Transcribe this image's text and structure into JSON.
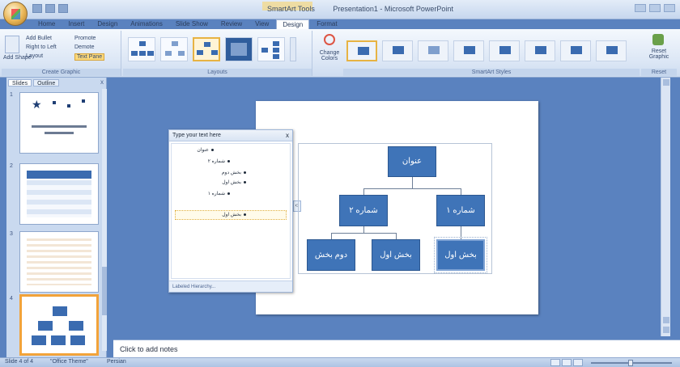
{
  "window": {
    "title": "SmartArt Tools",
    "title_full": "Presentation1 - Microsoft PowerPoint"
  },
  "tabs": [
    "Home",
    "Insert",
    "Design",
    "Animations",
    "Slide Show",
    "Review",
    "View",
    "Design",
    "Format"
  ],
  "ribbon": {
    "create_graphic": {
      "label": "Create Graphic",
      "add_shape": "Add Shape",
      "add_bullet": "Add Bullet",
      "right_to_left": "Right to Left",
      "layout": "Layout",
      "promote": "Promote",
      "demote": "Demote",
      "text_pane": "Text Pane"
    },
    "layouts": {
      "label": "Layouts"
    },
    "change_colors": "Change Colors",
    "styles": {
      "label": "SmartArt Styles"
    },
    "reset": {
      "label": "Reset",
      "reset_graphic": "Reset Graphic"
    }
  },
  "panel": {
    "tabs": [
      "Slides",
      "Outline"
    ],
    "close": "x",
    "slides": [
      {
        "num": "1"
      },
      {
        "num": "2"
      },
      {
        "num": "3"
      },
      {
        "num": "4"
      }
    ]
  },
  "text_pane": {
    "header": "Type your text here",
    "close": "x",
    "items": [
      {
        "text": "عنوان",
        "level": 0
      },
      {
        "text": "شماره ۲",
        "level": 1
      },
      {
        "text": "بخش دوم",
        "level": 2
      },
      {
        "text": "بخش اول",
        "level": 2
      },
      {
        "text": "شماره ۱",
        "level": 1
      },
      {
        "text": "بخش اول",
        "level": 2
      }
    ],
    "footer": "Labeled Hierarchy..."
  },
  "diagram": {
    "nodes": {
      "root": "عنوان",
      "left": "شماره ۲",
      "right": "شماره ۱",
      "ll": "دوم بخش",
      "lr": "بخش اول",
      "rr": "بخش اول"
    }
  },
  "notes": {
    "placeholder": "Click to add notes"
  },
  "status": {
    "slide": "Slide 4 of 4",
    "theme": "\"Office Theme\"",
    "language": "Persian"
  }
}
